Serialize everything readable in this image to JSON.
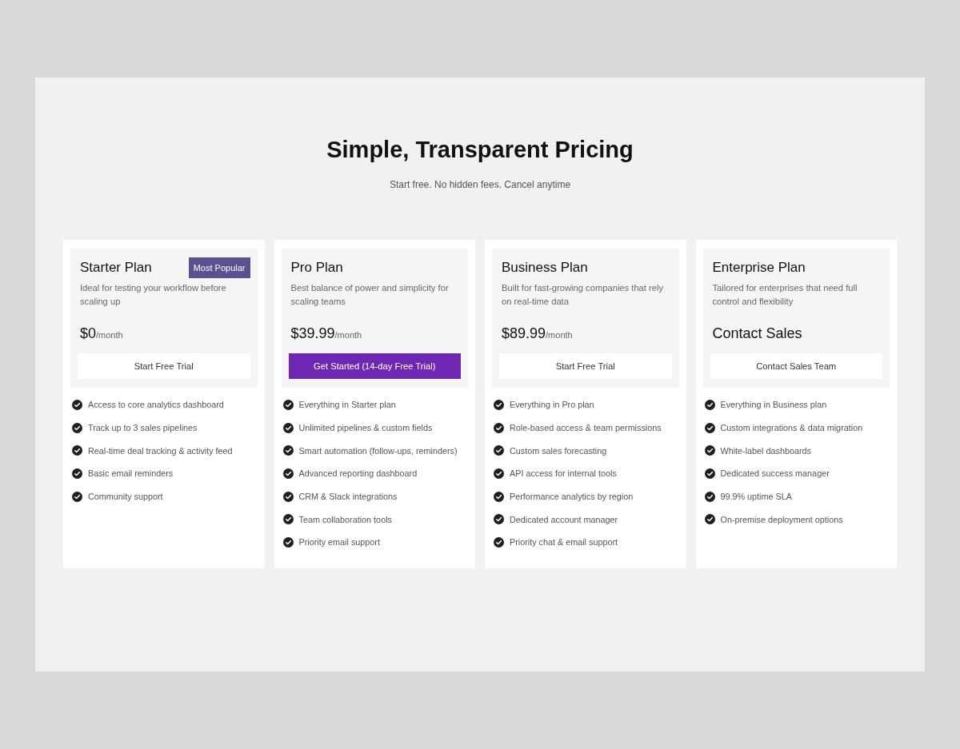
{
  "header": {
    "title": "Simple, Transparent Pricing",
    "subtitle": "Start free. No hidden fees. Cancel anytime"
  },
  "plans": [
    {
      "name": "Starter Plan",
      "badge": "Most Popular",
      "description": "Ideal for testing your workflow before scaling up",
      "price": "$0",
      "period": "/month",
      "button": {
        "label": "Start Free Trial",
        "primary": false
      },
      "features": [
        "Access to core analytics dashboard",
        "Track up to 3 sales pipelines",
        "Real-time deal tracking & activity feed",
        "Basic email reminders",
        "Community support"
      ]
    },
    {
      "name": "Pro Plan",
      "description": "Best balance of power and simplicity for scaling teams",
      "price": "$39.99",
      "period": "/month",
      "button": {
        "label": "Get Started (14-day Free Trial)",
        "primary": true
      },
      "features": [
        "Everything in Starter plan",
        "Unlimited pipelines & custom fields",
        "Smart automation (follow-ups, reminders)",
        "Advanced reporting dashboard",
        "CRM & Slack integrations",
        "Team collaboration tools",
        "Priority email support"
      ]
    },
    {
      "name": "Business Plan",
      "description": "Built for fast-growing companies that rely on real-time data",
      "price": "$89.99",
      "period": "/month",
      "button": {
        "label": "Start Free Trial",
        "primary": false
      },
      "features": [
        "Everything in Pro plan",
        "Role-based access & team permissions",
        "Custom sales forecasting",
        "API access for internal tools",
        "Performance analytics by region",
        "Dedicated account manager",
        "Priority chat & email support"
      ]
    },
    {
      "name": "Enterprise Plan",
      "description": "Tailored for enterprises that need full control and flexibility",
      "price": "Contact Sales",
      "button": {
        "label": "Contact Sales Team",
        "primary": false
      },
      "features": [
        "Everything in Business plan",
        "Custom integrations & data migration",
        "White-label dashboards",
        "Dedicated success manager",
        "99.9% uptime SLA",
        "On-premise deployment options"
      ]
    }
  ]
}
